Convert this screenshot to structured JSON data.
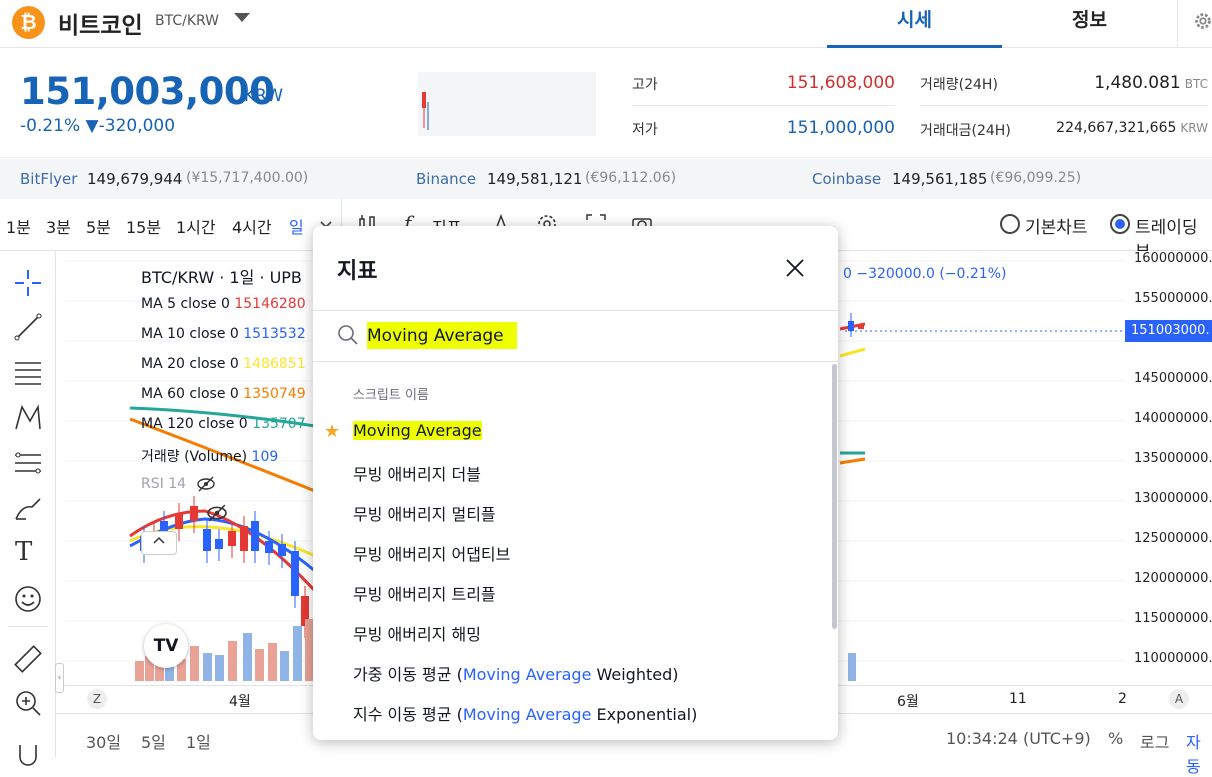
{
  "header": {
    "coin_symbol": "₿",
    "coin_name": "비트코인",
    "coin_code": "BTC/KRW",
    "tabs": [
      "시세",
      "정보"
    ]
  },
  "price": {
    "current": "151,003,000",
    "unit": "KRW",
    "change": "-0.21% ▼-320,000",
    "high_label": "고가",
    "high_value": "151,608,000",
    "low_label": "저가",
    "low_value": "151,000,000",
    "volume_label": "거래량(24H)",
    "volume_value": "1,480.081",
    "volume_unit": "BTC",
    "amount_label": "거래대금(24H)",
    "amount_value": "224,667,321,665",
    "amount_unit": "KRW"
  },
  "exchanges": [
    {
      "name": "BitFlyer",
      "price": "149,679,944",
      "sub": "(¥15,717,400.00)"
    },
    {
      "name": "Binance",
      "price": "149,581,121",
      "sub": "(€96,112.06)"
    },
    {
      "name": "Coinbase",
      "price": "149,561,185",
      "sub": "(€96,099.25)"
    }
  ],
  "toolbar": {
    "timeframes": [
      "1분",
      "3분",
      "5분",
      "15분",
      "1시간",
      "4시간",
      "일"
    ],
    "active_timeframe": "일",
    "indicator_label": "지표",
    "basic_chart": "기본차트",
    "tradingview": "트레이딩뷰"
  },
  "chart": {
    "title": "BTC/KRW · 1일 · UPB",
    "change_readout": "0  −320000.0 (−0.21%)",
    "current_price_label": "151003000.",
    "price_axis": [
      "160000000.",
      "155000000.",
      "150000000.",
      "145000000.",
      "140000000.",
      "135000000.",
      "130000000.",
      "125000000.",
      "120000000.",
      "115000000.",
      "110000000."
    ],
    "legend": [
      {
        "label": "MA 5 close 0",
        "value": "15146280",
        "color": "#e53935"
      },
      {
        "label": "MA 10 close 0",
        "value": "1513532",
        "color": "#2962ff"
      },
      {
        "label": "MA 20 close 0",
        "value": "1486851",
        "color": "#fbe52b"
      },
      {
        "label": "MA 60 close 0",
        "value": "1350749",
        "color": "#f57c00"
      },
      {
        "label": "MA 120 close 0",
        "value": "135707",
        "color": "#26a69a"
      }
    ],
    "volume_label": "거래량 (Volume)",
    "volume_value": "109",
    "rsi_label": "RSI 14",
    "time_axis": [
      "4월",
      "6월",
      "11",
      "2"
    ],
    "time_axis_left": "Z",
    "time_axis_right": "A"
  },
  "bottombar": {
    "ranges": [
      "30일",
      "5일",
      "1일"
    ],
    "clock": "10:34:24 (UTC+9)",
    "percent": "%",
    "log": "로그",
    "auto": "자동"
  },
  "dialog": {
    "title": "지표",
    "search_value": "Moving Average",
    "section_label": "스크립트 이름",
    "items": [
      {
        "prefix": "",
        "highlight": "Moving Average",
        "suffix": "",
        "starred": true
      },
      {
        "prefix": "무빙 애버리지 더블",
        "highlight": "",
        "suffix": "",
        "starred": false
      },
      {
        "prefix": "무빙 애버리지 멀티플",
        "highlight": "",
        "suffix": "",
        "starred": false
      },
      {
        "prefix": "무빙 애버리지 어댑티브",
        "highlight": "",
        "suffix": "",
        "starred": false
      },
      {
        "prefix": "무빙 애버리지 트리플",
        "highlight": "",
        "suffix": "",
        "starred": false
      },
      {
        "prefix": "무빙 애버리지 해밍",
        "highlight": "",
        "suffix": "",
        "starred": false
      },
      {
        "prefix": "가중 이동 평균 (",
        "highlight": "Moving Average",
        "suffix": " Weighted)",
        "starred": false
      },
      {
        "prefix": "지수 이동 평균 (",
        "highlight": "Moving Average",
        "suffix": " Exponential)",
        "starred": false
      }
    ]
  }
}
